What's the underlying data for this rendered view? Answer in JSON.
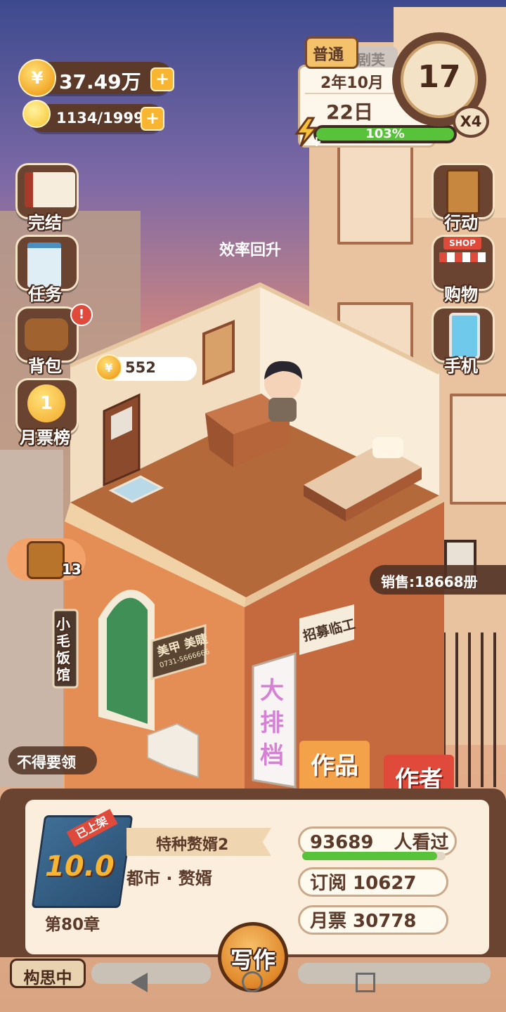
{
  "currency": {
    "coins": "37.49万",
    "energy": "1134/1999"
  },
  "calendar": {
    "mode": "普通",
    "back_tab": "剧芙",
    "year_month": "2年10月",
    "day": "22日",
    "clock": "17",
    "speed": "X4",
    "efficiency_percent": "103%",
    "efficiency_fill": 1.0
  },
  "left_menu": [
    {
      "label": "完结",
      "icon": "book-icon"
    },
    {
      "label": "任务",
      "icon": "checklist-icon"
    },
    {
      "label": "背包",
      "icon": "bag-icon",
      "badge": "!"
    },
    {
      "label": "月票榜",
      "icon": "medal-icon",
      "medal": "1"
    }
  ],
  "right_menu": [
    {
      "label": "行动",
      "icon": "door-icon"
    },
    {
      "label": "购物",
      "icon": "shop-icon",
      "sign": "SHOP"
    },
    {
      "label": "手机",
      "icon": "phone-icon"
    }
  ],
  "scene": {
    "floating_text": "效率回升",
    "coin_bubble": "552",
    "treasure_count": "13",
    "sales": "销售:18668册",
    "status_left": "不得要领",
    "sign_restaurant": "小毛饭馆",
    "sign_nail": "美甲 美睫",
    "sign_nail_phone": "0731-5666666",
    "sign_hiring": "招募临工",
    "sign_food": "大排档",
    "tab_works": "作品",
    "tab_author": "作者"
  },
  "book": {
    "shelf_tag": "已上架",
    "score": "10.0",
    "title": "特种赘婿2",
    "genre": "都市 · 赘婿",
    "chapter": "第80章"
  },
  "stats": {
    "readers": "93689",
    "readers_suffix": "人看过",
    "readers_fill": 0.94,
    "subscribe": "订阅 10627",
    "monthly": "月票 30778"
  },
  "bottom": {
    "thinking": "构思中",
    "write": "写作"
  },
  "colors": {
    "panel": "#fbeedd",
    "frame": "#6a4431",
    "green": "#58c23a",
    "orange": "#f3a24a",
    "red": "#e04a3a"
  }
}
